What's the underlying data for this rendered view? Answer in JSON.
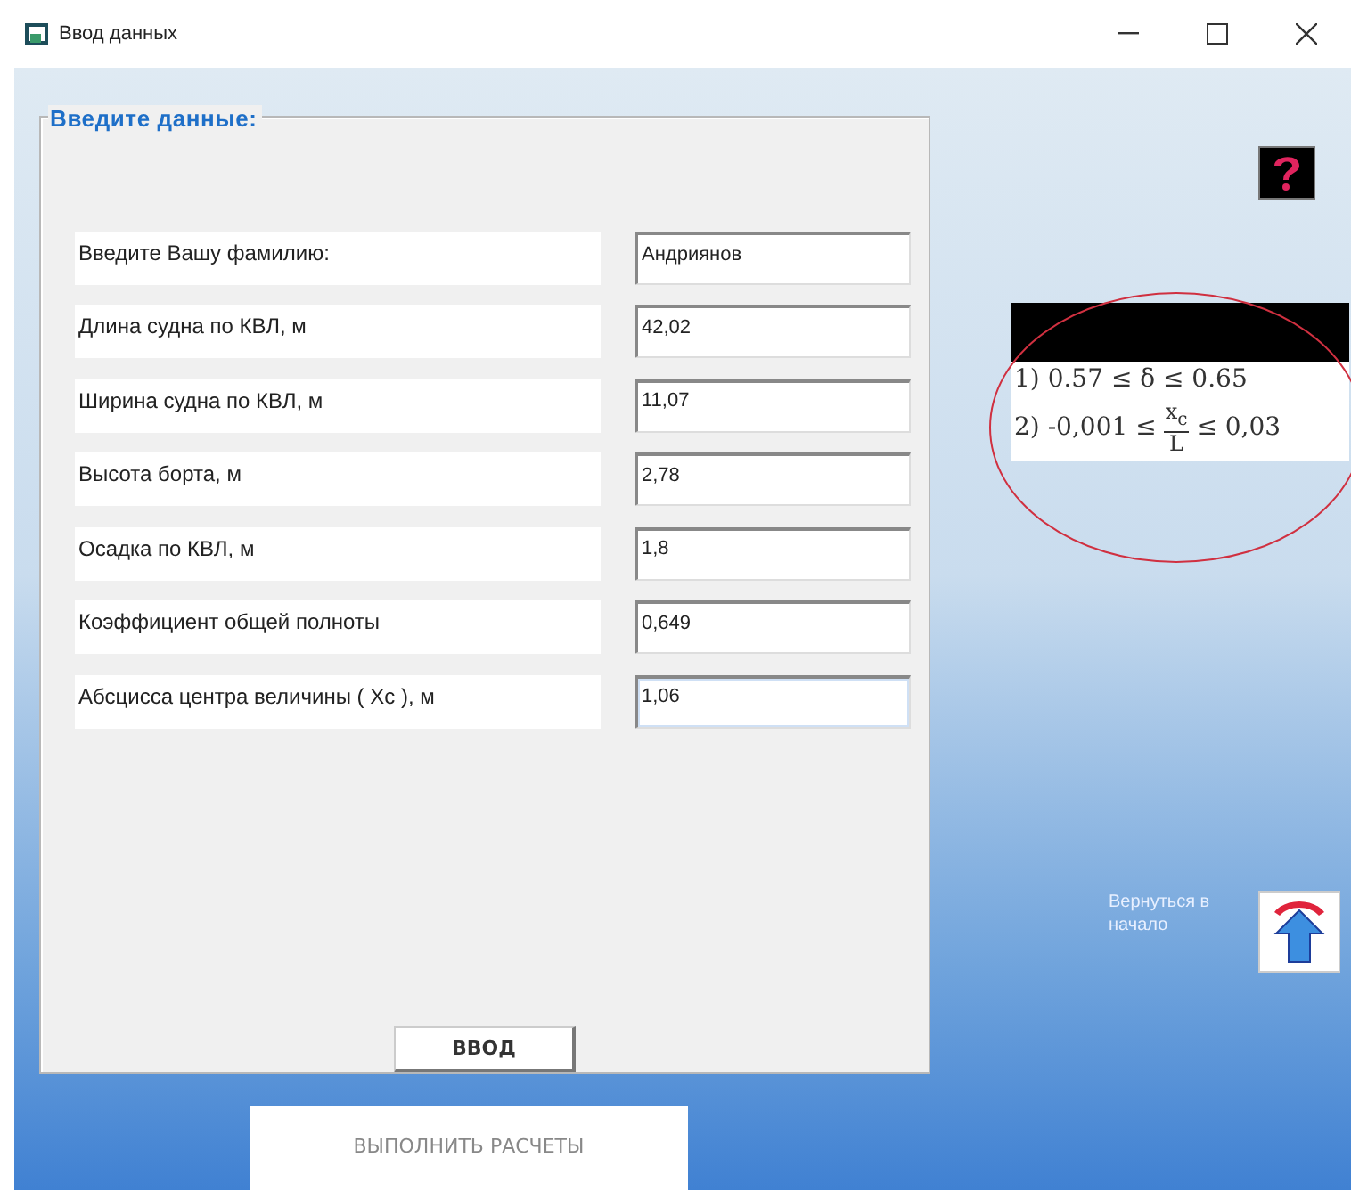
{
  "window": {
    "title": "Ввод данных"
  },
  "form": {
    "legend": "Введите данные:",
    "fields": [
      {
        "label": "Введите Вашу фамилию:",
        "value": "Андриянов",
        "focused": false
      },
      {
        "label": "Длина судна по КВЛ, м",
        "value": "42,02",
        "focused": false
      },
      {
        "label": "Ширина судна по КВЛ, м",
        "value": "11,07",
        "focused": false
      },
      {
        "label": "Высота борта, м",
        "value": "2,78",
        "focused": false
      },
      {
        "label": "Осадка по КВЛ, м",
        "value": "1,8",
        "focused": false
      },
      {
        "label": "Коэффициент общей полноты",
        "value": "0,649",
        "focused": false
      },
      {
        "label": "Абсцисса центра величины ( Xc ), м",
        "value": "1,06",
        "focused": true
      }
    ],
    "submit": "ВВОД"
  },
  "conditions": [
    {
      "kind": "text",
      "text": "1) 0.57 ≤ δ ≤ 0.65"
    },
    {
      "kind": "fraction",
      "prefix": "2) -0,001 ≤",
      "numerator": "x$_{c}$",
      "denominator": "L",
      "suffix": "≤ 0,03"
    }
  ],
  "return": {
    "label": "Вернуться в начало"
  },
  "calculate": "ВЫПОЛНИТЬ РАСЧЕТЫ"
}
